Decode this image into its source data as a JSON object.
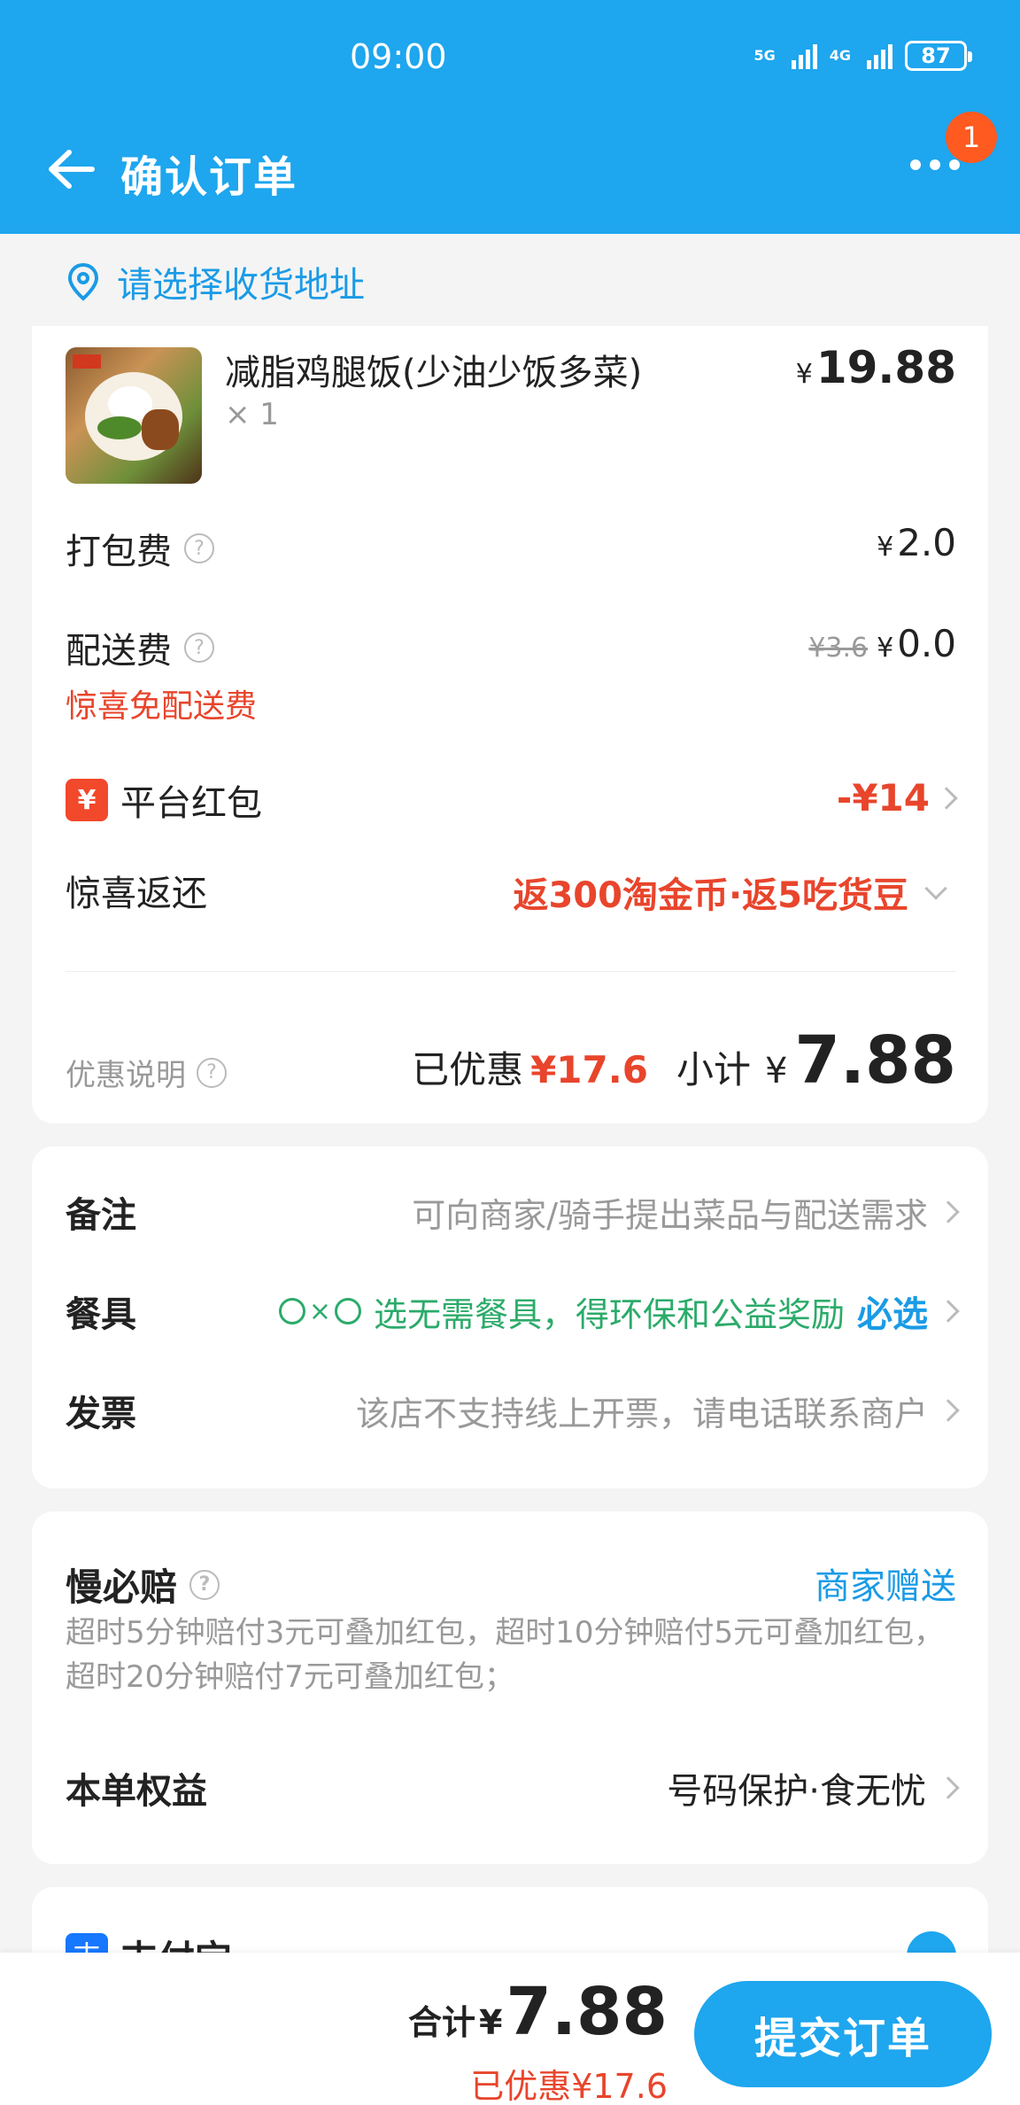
{
  "status_bar": {
    "time": "09:00",
    "net1": "5G",
    "net2": "4G",
    "battery": "87"
  },
  "nav": {
    "title": "确认订单",
    "badge_count": "1"
  },
  "address": {
    "prompt": "请选择收货地址"
  },
  "product": {
    "name": "减脂鸡腿饭(少油少饭多菜)",
    "qty": "× 1",
    "price": "19.88",
    "currency": "¥"
  },
  "fees": {
    "packing_label": "打包费",
    "packing_value": "2.0",
    "delivery_label": "配送费",
    "delivery_original": "¥3.6",
    "delivery_value": "0.0",
    "delivery_note": "惊喜免配送费"
  },
  "red_packet": {
    "icon": "¥",
    "label": "平台红包",
    "value": "-¥14"
  },
  "rebate": {
    "label": "惊喜返还",
    "value": "返300淘金币·返5吃货豆"
  },
  "summary": {
    "discount_label": "优惠说明",
    "saved_label": "已优惠",
    "saved_value": "¥17.6",
    "subtotal_label": "小计",
    "subtotal_value": "7.88"
  },
  "extras": {
    "note_label": "备注",
    "note_value": "可向商家/骑手提出菜品与配送需求",
    "tableware_label": "餐具",
    "tableware_value": "选无需餐具，得环保和公益奖励",
    "tableware_action": "必选",
    "invoice_label": "发票",
    "invoice_value": "该店不支持线上开票，请电话联系商户"
  },
  "guarantee": {
    "title": "慢必赔",
    "tag": "商家赠送",
    "desc": "超时5分钟赔付3元可叠加红包，超时10分钟赔付5元可叠加红包，超时20分钟赔付7元可叠加红包；",
    "rights_label": "本单权益",
    "rights_value": "号码保护·食无忧"
  },
  "payment": {
    "icon": "支",
    "name": "支付宝"
  },
  "bottom": {
    "total_label": "合计",
    "total_yen": "¥",
    "total_value": "7.88",
    "saved": "已优惠¥17.6",
    "submit": "提交订单"
  },
  "colors": {
    "brand": "#1ea6ee",
    "accent_red": "#e8452c",
    "link_blue": "#1a9be6"
  }
}
